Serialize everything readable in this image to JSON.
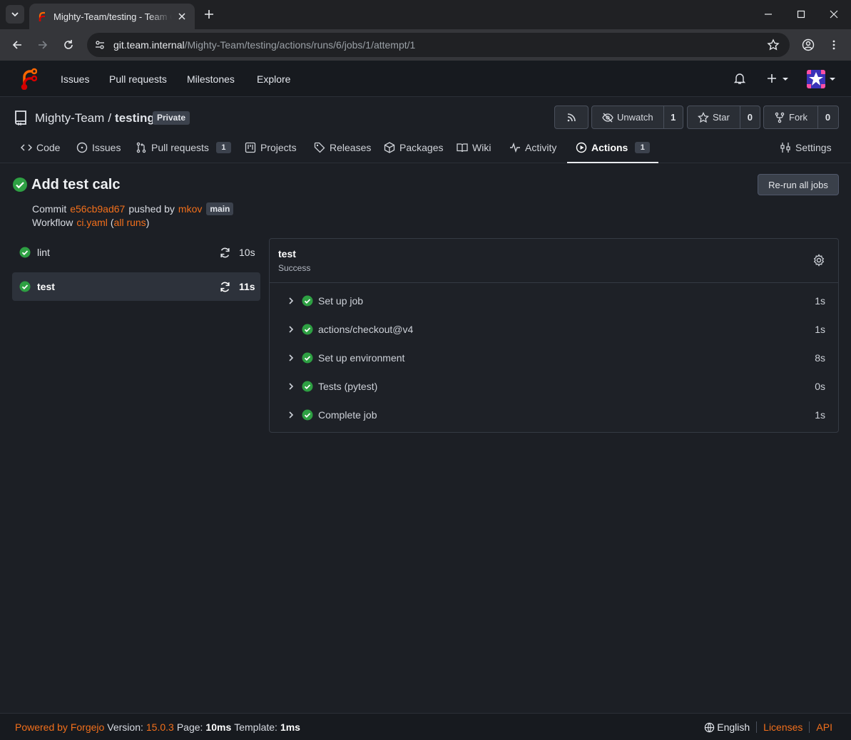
{
  "browser": {
    "tab_title": "Mighty-Team/testing - Team Code",
    "url_host": "git.team.internal",
    "url_path": "/Mighty-Team/testing/actions/runs/6/jobs/1/attempt/1"
  },
  "navbar": {
    "items": [
      "Issues",
      "Pull requests",
      "Milestones",
      "Explore"
    ]
  },
  "repo": {
    "owner": "Mighty-Team",
    "separator": "/",
    "name": "testing",
    "visibility": "Private",
    "unwatch_label": "Unwatch",
    "watch_count": "1",
    "star_label": "Star",
    "star_count": "0",
    "fork_label": "Fork",
    "fork_count": "0"
  },
  "tabs": {
    "code": "Code",
    "issues": "Issues",
    "pulls": "Pull requests",
    "pulls_count": "1",
    "projects": "Projects",
    "releases": "Releases",
    "packages": "Packages",
    "wiki": "Wiki",
    "activity": "Activity",
    "actions": "Actions",
    "actions_count": "1",
    "settings": "Settings"
  },
  "run": {
    "title": "Add test calc",
    "rerun_label": "Re-run all jobs",
    "commit_label": "Commit",
    "commit_sha": "e56cb9ad67",
    "pushed_by_label": "pushed by",
    "author": "mkov",
    "branch": "main",
    "workflow_label": "Workflow",
    "workflow_file": "ci.yaml",
    "all_runs_label": "all runs"
  },
  "jobs": [
    {
      "name": "lint",
      "duration": "10s"
    },
    {
      "name": "test",
      "duration": "11s"
    }
  ],
  "job_detail": {
    "name": "test",
    "status": "Success",
    "steps": [
      {
        "name": "Set up job",
        "duration": "1s"
      },
      {
        "name": "actions/checkout@v4",
        "duration": "1s"
      },
      {
        "name": "Set up environment",
        "duration": "8s"
      },
      {
        "name": "Tests (pytest)",
        "duration": "0s"
      },
      {
        "name": "Complete job",
        "duration": "1s"
      }
    ]
  },
  "footer": {
    "powered_by": "Powered by Forgejo",
    "version_label": "Version:",
    "version": "15.0.3",
    "page_label": "Page:",
    "page_time": "10ms",
    "template_label": "Template:",
    "template_time": "1ms",
    "language": "English",
    "licenses": "Licenses",
    "api": "API"
  },
  "colors": {
    "accent": "#f26f1b",
    "success": "#2ea043",
    "background": "#1c1f25"
  }
}
